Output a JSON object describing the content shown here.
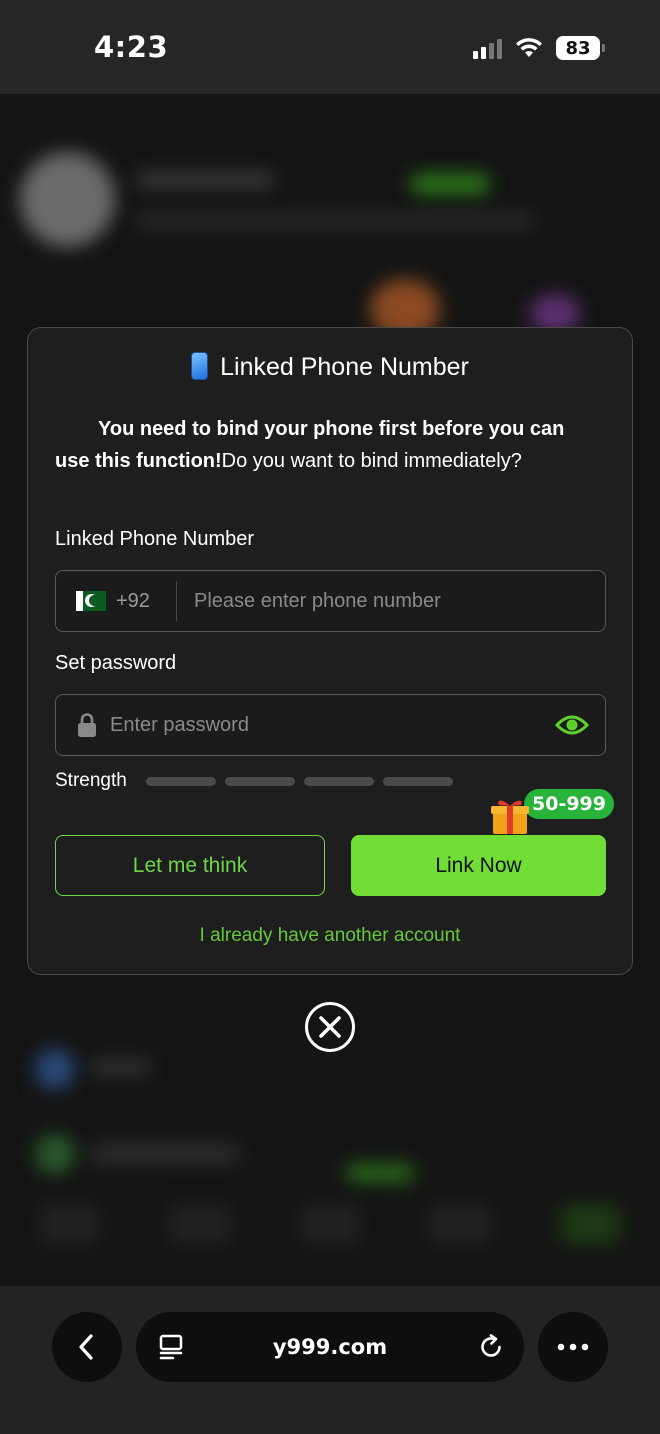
{
  "status_bar": {
    "time": "4:23",
    "battery": "83"
  },
  "dialog": {
    "title": "Linked Phone Number",
    "message_bold": "You need to bind your phone first before you can use this function!",
    "message_rest": "Do you want to bind immediately?",
    "phone_label": "Linked Phone Number",
    "country_code": "+92",
    "phone_placeholder": "Please enter phone number",
    "password_label": "Set password",
    "password_placeholder": "Enter password",
    "strength_label": "Strength",
    "bonus_badge": "50-999",
    "think_button": "Let me think",
    "link_button": "Link Now",
    "alt_account_link": "I already have another account"
  },
  "browser": {
    "url": "y999.com"
  },
  "colors": {
    "accent_green": "#72dd34",
    "link_green": "#66c93d",
    "badge_green": "#28b33a"
  },
  "icons": [
    "phone-icon",
    "pakistan-flag-icon",
    "lock-icon",
    "eye-icon",
    "gift-icon",
    "close-icon",
    "back-arrow-icon",
    "tabs-icon",
    "reload-icon",
    "more-icon"
  ]
}
